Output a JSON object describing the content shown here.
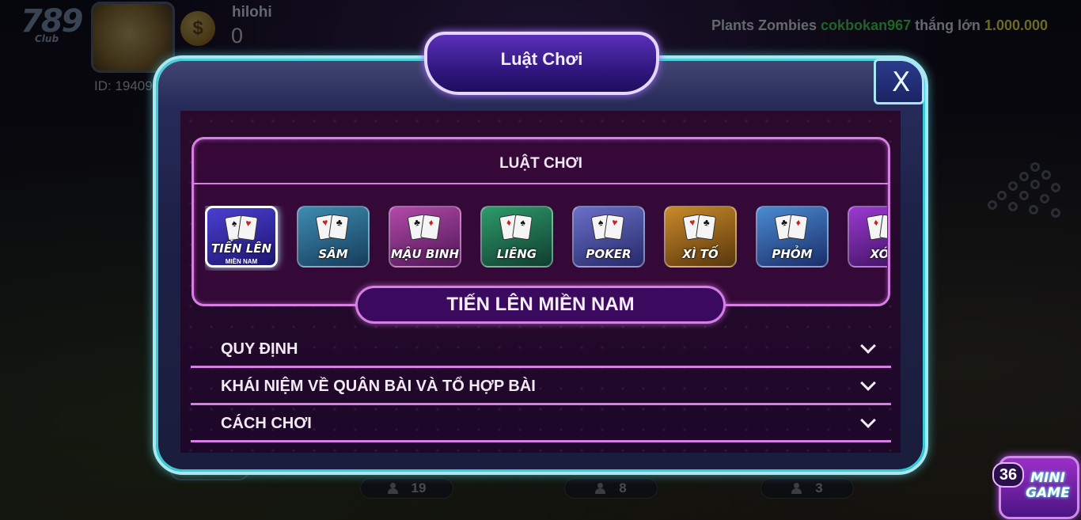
{
  "lobby": {
    "logo": "789",
    "logo_sub": "Club",
    "username": "hilohi",
    "balance": "0",
    "user_id": "ID: 19409",
    "ticker": {
      "game": "Plants Zombies",
      "player": "cokbokan967",
      "verb": "thắng lớn",
      "amount": "1.000.000"
    },
    "room_tag": "Luật Chơi",
    "room_counts": [
      "19",
      "8",
      "3"
    ],
    "mini_game": {
      "label_line1": "MINI",
      "label_line2": "GAME",
      "badge": "36"
    }
  },
  "modal": {
    "title": "Luật Chơi",
    "close_label": "X",
    "games_heading": "LUẬT CHƠI",
    "games": [
      {
        "name": "TIẾN LÊN",
        "sub": "MIỀN NAM",
        "colors": [
          "#4a3fd0",
          "#1d1570"
        ],
        "active": true
      },
      {
        "name": "SÂM",
        "sub": "",
        "colors": [
          "#3e8bb0",
          "#163d5c"
        ],
        "active": false
      },
      {
        "name": "MẬU BINH",
        "sub": "",
        "colors": [
          "#b24aa8",
          "#4e1556"
        ],
        "active": false
      },
      {
        "name": "LIÊNG",
        "sub": "",
        "colors": [
          "#2e9a6a",
          "#0f3e30"
        ],
        "active": false
      },
      {
        "name": "POKER",
        "sub": "",
        "colors": [
          "#6a6fc8",
          "#252a6a"
        ],
        "active": false
      },
      {
        "name": "XÌ TỐ",
        "sub": "",
        "colors": [
          "#c88a2a",
          "#5a360c"
        ],
        "active": false
      },
      {
        "name": "PHỎM",
        "sub": "",
        "colors": [
          "#4a8ad0",
          "#1a2e6a"
        ],
        "active": false
      },
      {
        "name": "XÓC",
        "sub": "",
        "colors": [
          "#9a3ad0",
          "#3a0f5a"
        ],
        "active": false
      }
    ],
    "selected_game": "TIẾN LÊN MIỀN NAM",
    "sections": [
      "QUY ĐỊNH",
      "KHÁI NIỆM VỀ QUÂN BÀI VÀ TỔ HỢP BÀI",
      "CÁCH CHƠI"
    ]
  }
}
